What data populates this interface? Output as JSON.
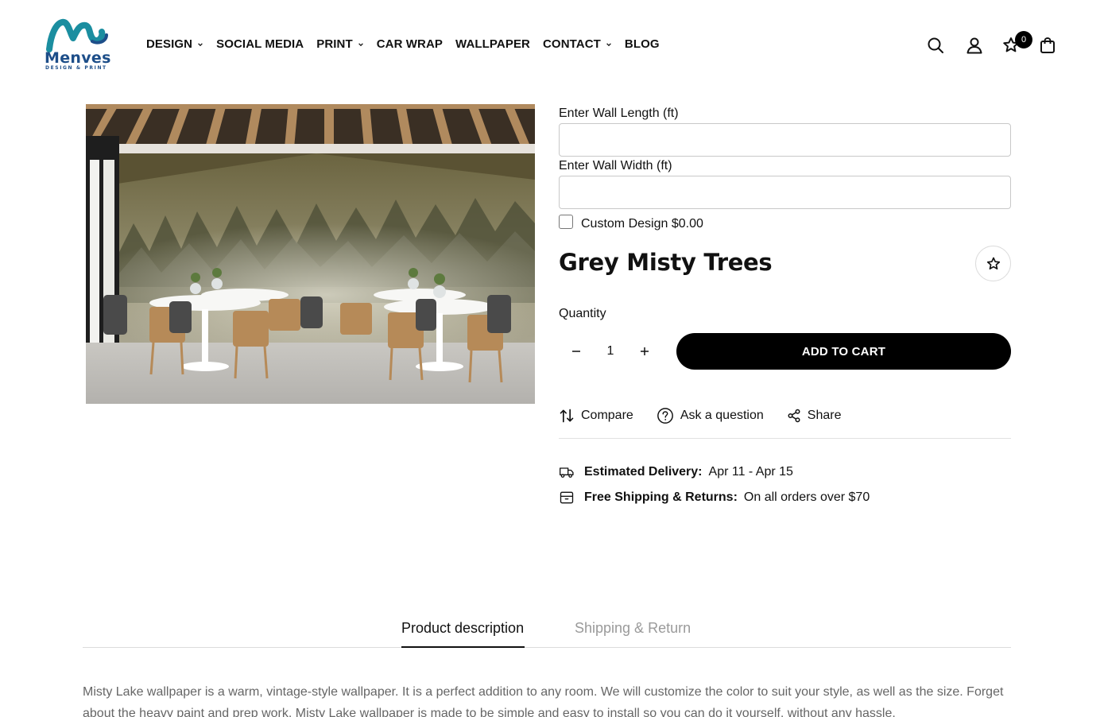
{
  "brand": {
    "name": "Menves",
    "tagline": "DESIGN & PRINT",
    "colors": {
      "teal": "#1b8ea0",
      "navy": "#1d4e89"
    }
  },
  "nav": [
    {
      "label": "DESIGN",
      "has_dropdown": true
    },
    {
      "label": "SOCIAL MEDIA",
      "has_dropdown": false
    },
    {
      "label": "PRINT",
      "has_dropdown": true
    },
    {
      "label": "CAR WRAP",
      "has_dropdown": false
    },
    {
      "label": "WALLPAPER",
      "has_dropdown": false
    },
    {
      "label": "CONTACT",
      "has_dropdown": true
    },
    {
      "label": "BLOG",
      "has_dropdown": false
    }
  ],
  "header_icons": {
    "search": "search-icon",
    "account": "user-icon",
    "wishlist": "star-icon",
    "cart": "bag-icon",
    "wishlist_count": "0"
  },
  "product": {
    "title": "Grey Misty Trees",
    "image_alt": "Cafe interior with misty forest wallpaper",
    "wall_length": {
      "label": "Enter Wall Length (ft)",
      "value": ""
    },
    "wall_width": {
      "label": "Enter Wall Width (ft)",
      "value": ""
    },
    "custom_design": {
      "label": "Custom Design $0.00",
      "checked": false
    },
    "quantity": {
      "label": "Quantity",
      "value": "1"
    },
    "add_to_cart": "ADD TO CART"
  },
  "actions": [
    {
      "icon": "compare-icon",
      "label": "Compare"
    },
    {
      "icon": "question-icon",
      "label": "Ask a question"
    },
    {
      "icon": "share-icon",
      "label": "Share"
    }
  ],
  "info": {
    "delivery": {
      "icon": "truck-icon",
      "label": "Estimated Delivery:",
      "value": "Apr 11 - Apr 15"
    },
    "shipping": {
      "icon": "box-icon",
      "label": "Free Shipping & Returns:",
      "value": "On all orders over $70"
    }
  },
  "tabs": [
    {
      "label": "Product description",
      "active": true
    },
    {
      "label": "Shipping & Return",
      "active": false
    }
  ],
  "description": "Misty Lake wallpaper is a warm, vintage-style wallpaper. It is a perfect addition to any room. We will customize the color to suit your style, as well as the size. Forget about the heavy paint and prep work. Misty Lake wallpaper is made to be simple and easy to install so you can do it yourself, without any hassle."
}
